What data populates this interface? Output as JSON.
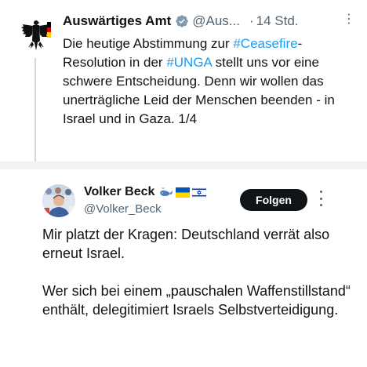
{
  "quoted_tweet": {
    "display_name": "Auswärtiges Amt",
    "handle": "@Aus...",
    "separator": "·",
    "time": "14 Std.",
    "more": "⋮",
    "text_parts": {
      "p1": "Die heutige Abstimmung zur ",
      "hashtag1": "#Ceasefire",
      "p2": "-Resolution in der ",
      "hashtag2": "#UNGA",
      "p3": " stellt uns vor eine schwere Entscheidung. Denn wir wollen das unerträgliche Leid der Menschen beenden - in Israel und in Gaza. 1/4"
    }
  },
  "main_tweet": {
    "display_name": "Volker Beck",
    "handle": "@Volker_Beck",
    "follow_label": "Folgen",
    "paragraph1": "Mir platzt der Kragen: Deutschland verrät also erneut Israel.",
    "paragraph2": "Wer sich bei einem „pauschalen Waffenstillstand“ enthält, delegitimiert Israels Selbstverteidigung."
  },
  "colors": {
    "text": "#0f1419",
    "secondary": "#536471",
    "link": "#1d9bf0",
    "verified_gray": "#829aab",
    "follow_bg": "#0f1419"
  },
  "icons": [
    "eagle-avatar",
    "verified-badge-gray",
    "whale-icon",
    "ukraine-flag-icon",
    "israel-flag-icon",
    "more-icon"
  ]
}
